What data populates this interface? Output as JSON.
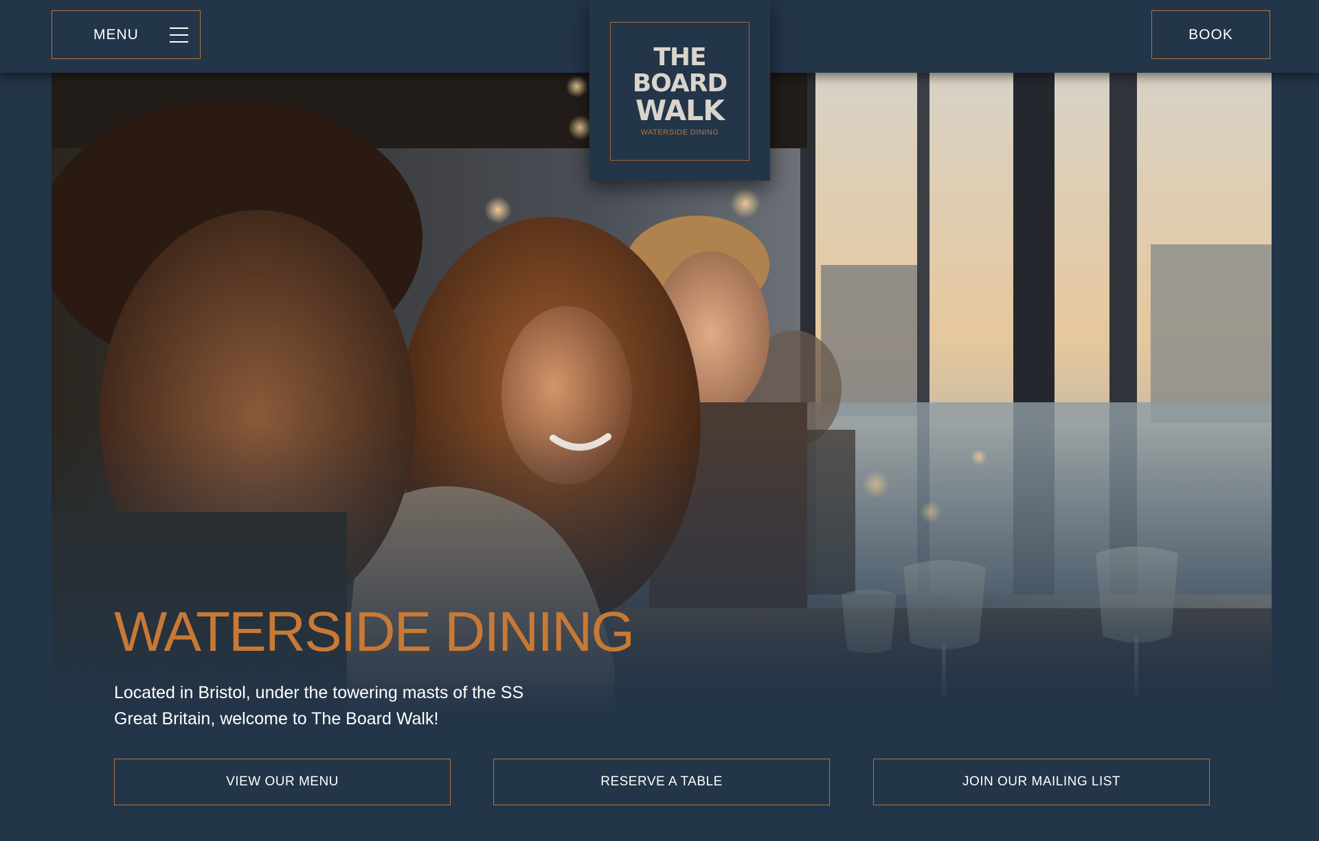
{
  "header": {
    "menu_label": "MENU",
    "book_label": "BOOK"
  },
  "logo": {
    "line1": "THE",
    "line2": "BOARD",
    "line3": "WALK",
    "subtitle": "WATERSIDE DINING"
  },
  "hero": {
    "title": "WATERSIDE DINING",
    "description": "Located in Bristol, under the towering masts of the SS Great Britain, welcome to The Board Walk!",
    "image_icon": "photo-diners-at-waterside-table"
  },
  "actions": {
    "view_menu": "VIEW OUR MENU",
    "reserve_table": "RESERVE A TABLE",
    "mailing_list": "JOIN OUR MAILING LIST"
  },
  "colors": {
    "background": "#233548",
    "accent": "#b8743f",
    "title_accent": "#c87935",
    "text": "#ffffff"
  }
}
